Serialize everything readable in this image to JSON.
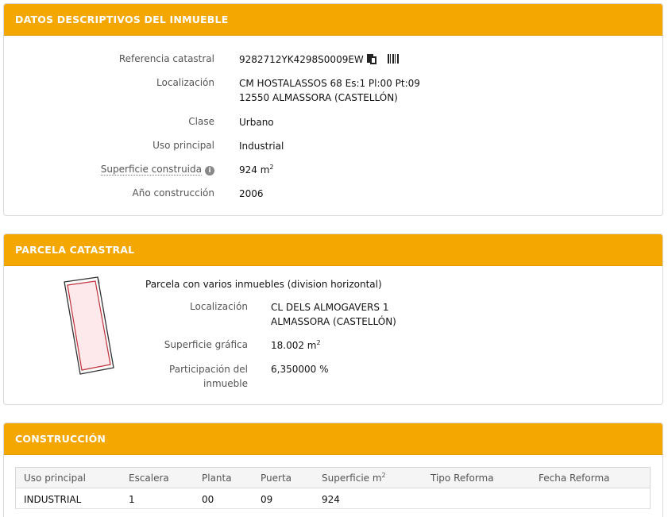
{
  "datos": {
    "header": "DATOS DESCRIPTIVOS DEL INMUEBLE",
    "referencia_label": "Referencia catastral",
    "referencia_value": "9282712YK4298S0009EW",
    "localizacion_label": "Localización",
    "localizacion_line1": "CM HOSTALASSOS 68 Es:1 Pl:00 Pt:09",
    "localizacion_line2": "12550 ALMASSORA (CASTELLÓN)",
    "clase_label": "Clase",
    "clase_value": "Urbano",
    "uso_label": "Uso principal",
    "uso_value": "Industrial",
    "superficie_label": "Superficie construida",
    "superficie_value": "924 m",
    "superficie_sup": "2",
    "anio_label": "Año construcción",
    "anio_value": "2006",
    "info_icon": "i"
  },
  "parcela": {
    "header": "PARCELA CATASTRAL",
    "title": "Parcela con varios inmuebles (division horizontal)",
    "localizacion_label": "Localización",
    "localizacion_line1": "CL DELS ALMOGAVERS 1",
    "localizacion_line2": "ALMASSORA (CASTELLÓN)",
    "superficie_label": "Superficie gráfica",
    "superficie_value": "18.002 m",
    "superficie_sup": "2",
    "participacion_label_line1": "Participación del",
    "participacion_label_line2": "inmueble",
    "participacion_value": "6,350000 %"
  },
  "construccion": {
    "header": "CONSTRUCCIÓN",
    "columns": [
      "Uso principal",
      "Escalera",
      "Planta",
      "Puerta",
      "Superficie m",
      "Tipo Reforma",
      "Fecha Reforma"
    ],
    "superficie_sup": "2",
    "rows": [
      [
        "INDUSTRIAL",
        "1",
        "00",
        "09",
        "924",
        "",
        ""
      ]
    ]
  },
  "colors": {
    "header_bg": "#f4a700",
    "parcel_fill": "#fde8ec",
    "parcel_stroke": "#c0303a"
  },
  "icons": [
    "copy-icon",
    "barcode-icon",
    "info-icon"
  ]
}
